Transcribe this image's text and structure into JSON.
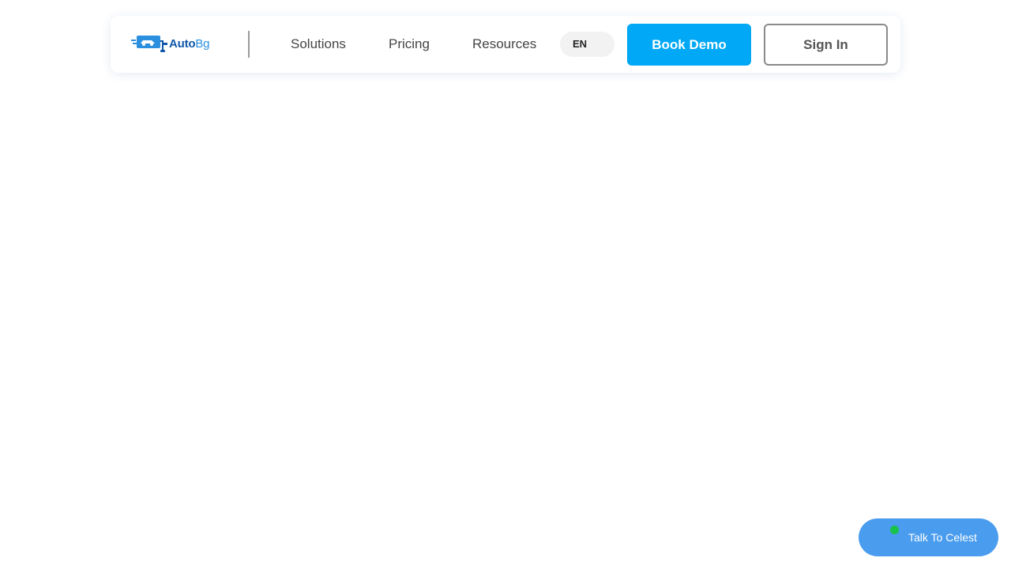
{
  "header": {
    "logo": {
      "brand_bold": "Auto",
      "brand_light": "Bg",
      "icon": "car-roller-logo-icon"
    },
    "nav": {
      "solutions": "Solutions",
      "pricing": "Pricing",
      "resources": "Resources"
    },
    "language": "EN",
    "book_demo_label": "Book Demo",
    "sign_in_label": "Sign In"
  },
  "chat_widget": {
    "label": "Talk To Celest",
    "status_icon": "online-status-dot-icon"
  },
  "colors": {
    "primary_button": "#00a8f5",
    "chat_button": "#4a9cee",
    "online_dot": "#19c24a",
    "brand_dark": "#0e57a8",
    "brand_light": "#2b8fe0"
  }
}
